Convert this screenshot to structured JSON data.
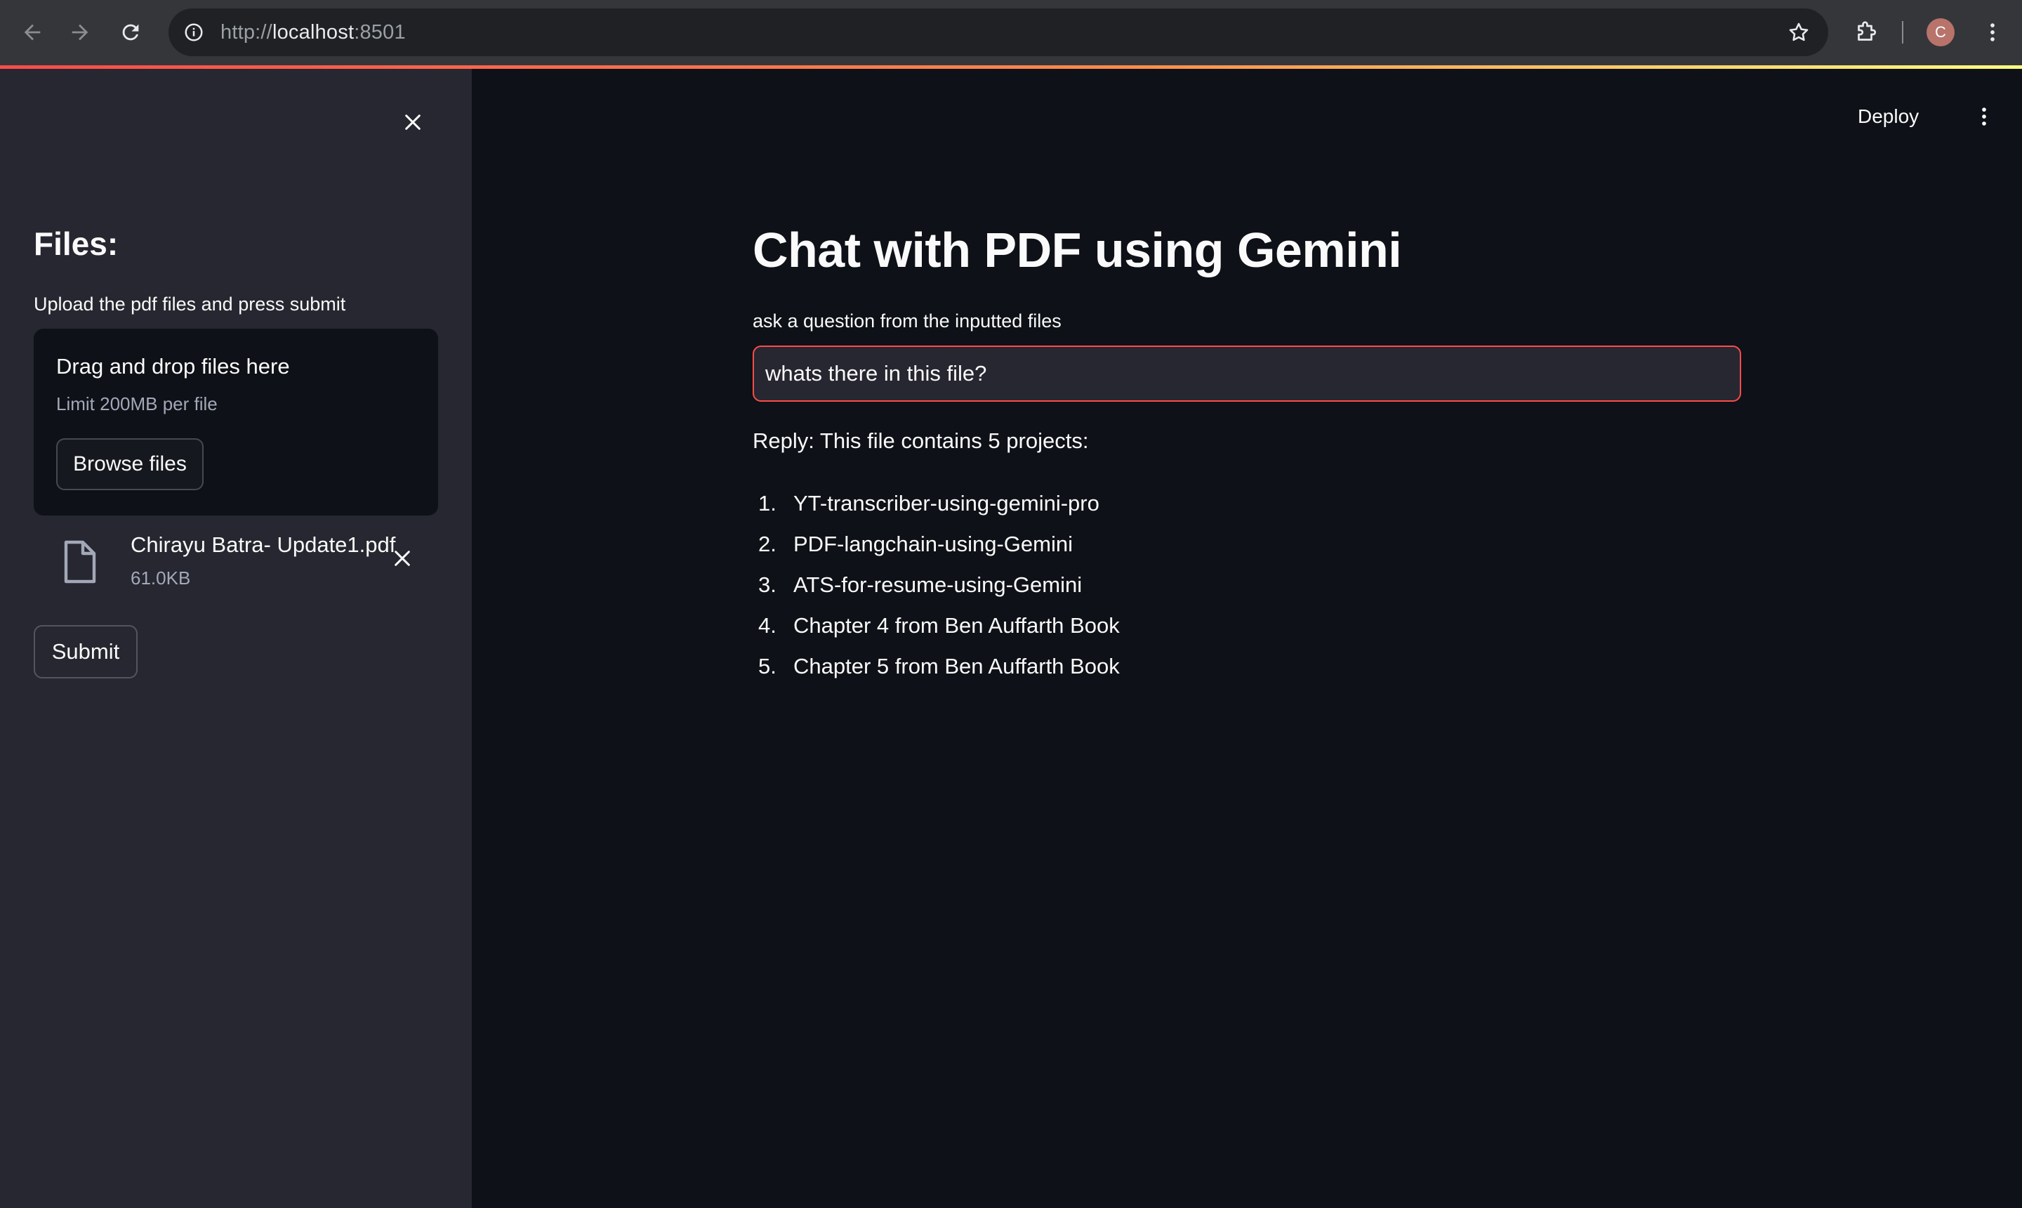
{
  "browser": {
    "url_scheme": "http://",
    "url_host": "localhost",
    "url_port": ":8501",
    "profile_initial": "C"
  },
  "sidebar": {
    "title": "Files:",
    "subtitle": "Upload the pdf files and press submit",
    "dropzone": {
      "title": "Drag and drop files here",
      "limit": "Limit 200MB per file",
      "browse_label": "Browse files"
    },
    "uploaded_file": {
      "name": "Chirayu Batra- Update1.pdf",
      "size": "61.0KB"
    },
    "submit_label": "Submit"
  },
  "header": {
    "deploy_label": "Deploy"
  },
  "main": {
    "title": "Chat with PDF using Gemini",
    "question_label": "ask a question from the inputted files",
    "question_value": "whats there in this file?",
    "reply_text": "Reply: This file contains 5 projects:",
    "reply_items": [
      {
        "num": "1.",
        "text": "YT-transcriber-using-gemini-pro"
      },
      {
        "num": "2.",
        "text": "PDF-langchain-using-Gemini"
      },
      {
        "num": "3.",
        "text": "ATS-for-resume-using-Gemini"
      },
      {
        "num": "4.",
        "text": "Chapter 4 from Ben Auffarth Book"
      },
      {
        "num": "5.",
        "text": "Chapter 5 from Ben Auffarth Book"
      }
    ]
  },
  "colors": {
    "accent": "#ff4b4b",
    "sidebar_bg": "#262730",
    "main_bg": "#0e1117",
    "chrome_bg": "#35363a"
  },
  "icons": [
    "back-arrow-icon",
    "forward-arrow-icon",
    "reload-icon",
    "site-info-icon",
    "bookmark-star-icon",
    "extensions-puzzle-icon",
    "kebab-menu-icon",
    "close-icon",
    "file-icon"
  ]
}
